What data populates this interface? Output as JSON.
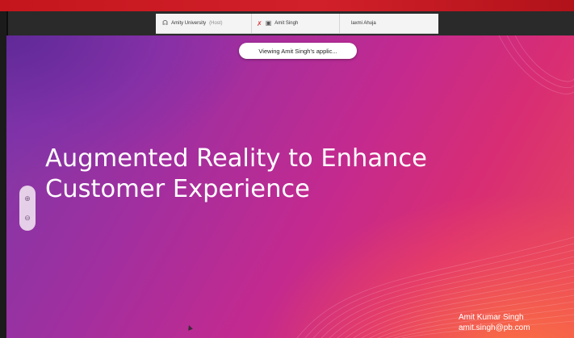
{
  "meeting": {
    "participants": [
      {
        "name": "Amity University",
        "tag": "(Host)",
        "icon": "headset-icon"
      },
      {
        "name": "Amit Singh",
        "icon": "share-screen-icon",
        "muted_icon": "mic-muted-icon"
      },
      {
        "name": "laxmi Ahuja"
      }
    ],
    "viewing_notice": "Viewing Amit Singh's applic..."
  },
  "slide": {
    "title_line1": "Augmented Reality to Enhance",
    "title_line2": "Customer Experience",
    "author_name": "Amit Kumar Singh",
    "author_email": "amit.singh@pb.com"
  },
  "zoom": {
    "in_icon": "zoom-in-icon",
    "out_icon": "zoom-out-icon"
  },
  "colors": {
    "top_bar": "#d2202a",
    "meeting_bar": "#2a2a2a",
    "slide_gradient": [
      "#7a3aa8",
      "#c32a8f",
      "#e6485a"
    ]
  }
}
